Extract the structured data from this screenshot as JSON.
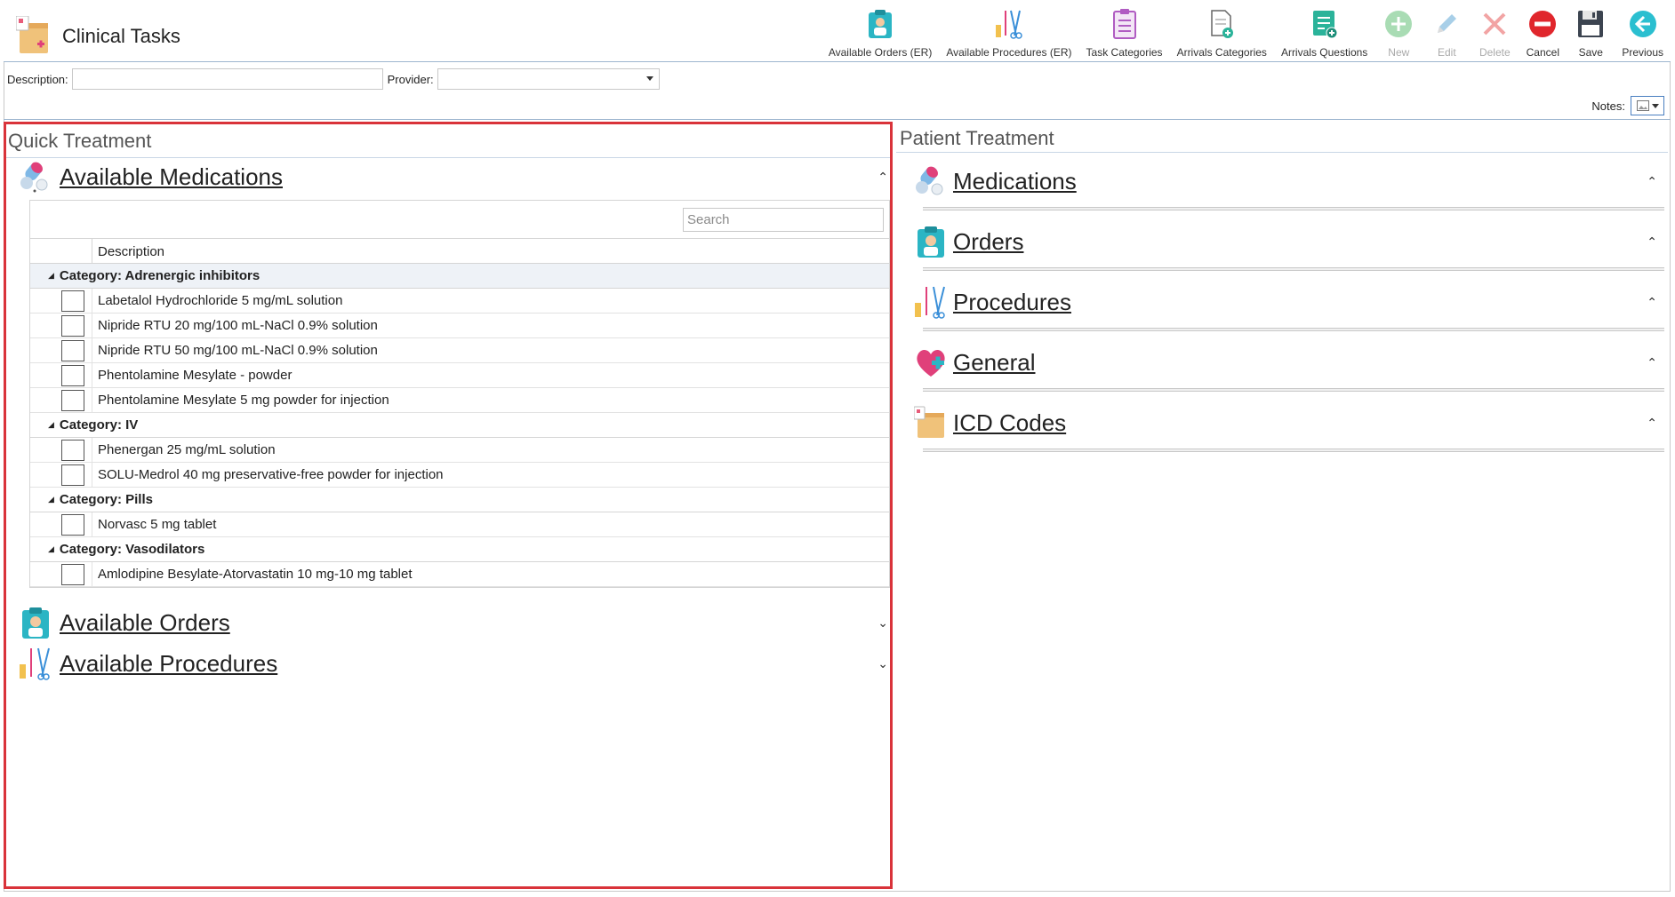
{
  "app": {
    "title": "Clinical Tasks"
  },
  "toolbar": {
    "buttons": [
      {
        "label": "Available Orders (ER)",
        "icon": "clipboard-doctor-icon",
        "disabled": false
      },
      {
        "label": "Available Procedures (ER)",
        "icon": "surgical-tools-icon",
        "disabled": false
      },
      {
        "label": "Task Categories",
        "icon": "checklist-icon",
        "disabled": false
      },
      {
        "label": "Arrivals Categories",
        "icon": "document-add-icon",
        "disabled": false
      },
      {
        "label": "Arrivals Questions",
        "icon": "questions-icon",
        "disabled": false
      },
      {
        "label": "New",
        "icon": "plus-circle-icon",
        "disabled": true
      },
      {
        "label": "Edit",
        "icon": "pencil-icon",
        "disabled": true
      },
      {
        "label": "Delete",
        "icon": "x-icon",
        "disabled": true
      },
      {
        "label": "Cancel",
        "icon": "minus-circle-icon",
        "disabled": false
      },
      {
        "label": "Save",
        "icon": "floppy-disk-icon",
        "disabled": false
      },
      {
        "label": "Previous",
        "icon": "arrow-left-circle-icon",
        "disabled": false
      }
    ]
  },
  "filters": {
    "description_label": "Description:",
    "description_value": "",
    "provider_label": "Provider:",
    "provider_value": ""
  },
  "notes": {
    "label": "Notes:"
  },
  "quick_treatment": {
    "title": "Quick Treatment",
    "sections": [
      {
        "title": "Available Medications",
        "expanded": true
      },
      {
        "title": "Available Orders",
        "expanded": false
      },
      {
        "title": "Available Procedures",
        "expanded": false
      }
    ],
    "grid": {
      "search_placeholder": "Search",
      "column_header": "Description",
      "categories": [
        {
          "label": "Category: Adrenergic inhibitors",
          "items": [
            "Labetalol Hydrochloride 5 mg/mL solution",
            "Nipride RTU 20 mg/100 mL-NaCl 0.9% solution",
            "Nipride RTU 50 mg/100 mL-NaCl 0.9% solution",
            "Phentolamine Mesylate - powder",
            "Phentolamine Mesylate 5 mg powder for injection"
          ]
        },
        {
          "label": "Category: IV",
          "items": [
            "Phenergan 25 mg/mL solution",
            "SOLU-Medrol 40 mg preservative-free powder for injection"
          ]
        },
        {
          "label": "Category: Pills",
          "items": [
            "Norvasc 5 mg tablet"
          ]
        },
        {
          "label": "Category: Vasodilators",
          "items": [
            "Amlodipine Besylate-Atorvastatin 10 mg-10 mg tablet"
          ]
        }
      ]
    }
  },
  "patient_treatment": {
    "title": "Patient Treatment",
    "sections": [
      {
        "title": "Medications",
        "icon": "pills-icon"
      },
      {
        "title": "Orders",
        "icon": "clipboard-doctor-icon"
      },
      {
        "title": "Procedures",
        "icon": "surgical-tools-icon"
      },
      {
        "title": "General",
        "icon": "heart-plus-icon"
      },
      {
        "title": "ICD Codes",
        "icon": "folder-medical-icon"
      }
    ]
  },
  "colors": {
    "highlight_border": "#d9333a",
    "accent_blue": "#4a7fc0"
  }
}
